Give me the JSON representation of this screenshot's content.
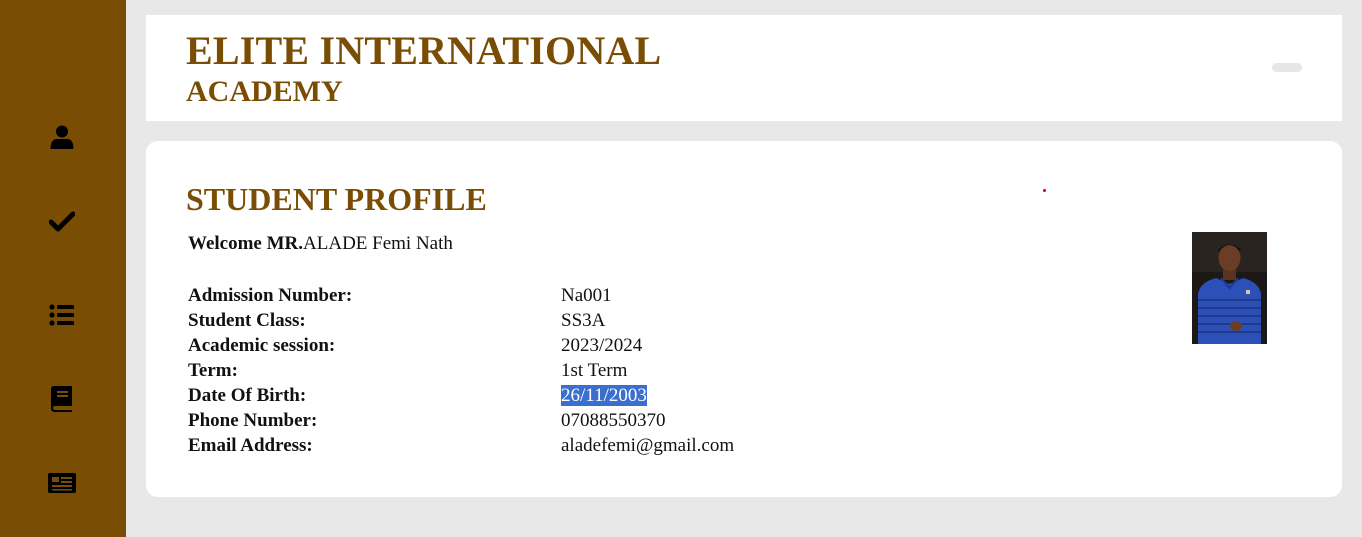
{
  "sidebar": {
    "items": [
      {
        "icon": "user-icon"
      },
      {
        "icon": "check-icon"
      },
      {
        "icon": "list-icon"
      },
      {
        "icon": "book-icon"
      },
      {
        "icon": "newspaper-icon"
      }
    ]
  },
  "header": {
    "school_name_line1": "ELITE INTERNATIONAL",
    "school_name_line2": "ACADEMY"
  },
  "profile": {
    "title": "STUDENT PROFILE",
    "welcome_prefix": "Welcome MR.",
    "student_name": "ALADE Femi Nath",
    "fields": [
      {
        "label": "Admission Number:",
        "value": "Na001"
      },
      {
        "label": "Student Class:",
        "value": "SS3A"
      },
      {
        "label": "Academic session:",
        "value": "2023/2024"
      },
      {
        "label": "Term:",
        "value": "1st Term"
      },
      {
        "label": "Date Of Birth:",
        "value": "26/11/2003"
      },
      {
        "label": "Phone Number:",
        "value": "07088550370"
      },
      {
        "label": "Email Address:",
        "value": "aladefemi@gmail.com"
      }
    ]
  },
  "colors": {
    "brand": "#7a4d05",
    "background": "#e9e8e8",
    "selection": "#3a6fd0"
  }
}
